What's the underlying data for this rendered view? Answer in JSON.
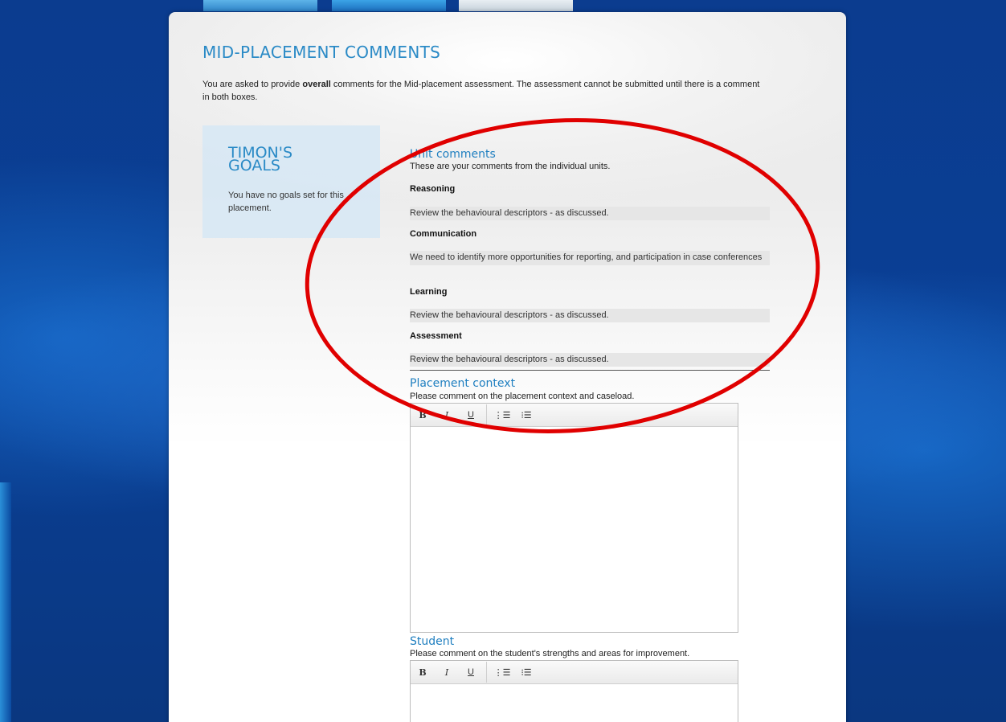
{
  "page": {
    "title": "MID-PLACEMENT COMMENTS",
    "intro_prefix": "You are asked to provide ",
    "intro_bold": "overall",
    "intro_suffix": " comments for the Mid-placement assessment. The assessment cannot be submitted until there is a comment in both boxes."
  },
  "goals": {
    "title": "TIMON'S GOALS",
    "text": "You have no goals set for this placement."
  },
  "unit_comments": {
    "title": "Unit comments",
    "subtitle": "These are your comments from the individual units.",
    "units": [
      {
        "label": "Reasoning",
        "comment": "Review the behavioural descriptors - as discussed."
      },
      {
        "label": "Communication",
        "comment": "We need to identify more opportunities for reporting, and participation in case conferences"
      },
      {
        "label": "Learning",
        "comment": "Review the behavioural descriptors - as discussed."
      },
      {
        "label": "Assessment",
        "comment": "Review the behavioural descriptors - as discussed."
      }
    ]
  },
  "placement_context": {
    "title": "Placement context",
    "subtitle": "Please comment on the placement context and caseload."
  },
  "student": {
    "title": "Student",
    "subtitle": "Please comment on the student's strengths and areas for improvement."
  },
  "toolbar": {
    "bold": "B",
    "italic": "I",
    "underline": "U",
    "ordered_list": "⋮☰",
    "unordered_list": "⁝☰"
  },
  "annotation": {
    "color": "#e00000"
  }
}
